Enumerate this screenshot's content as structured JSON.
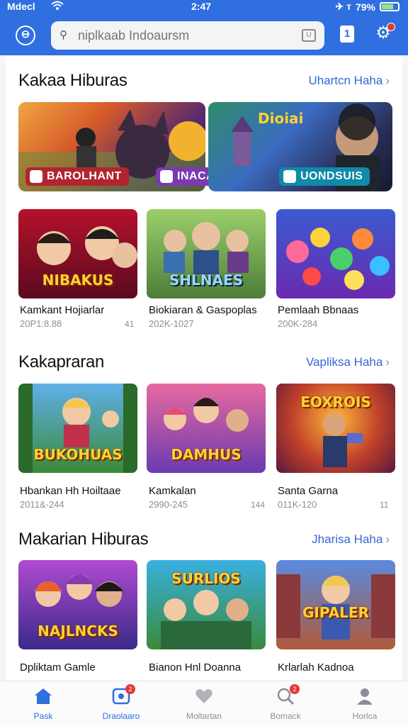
{
  "status": {
    "carrier": "Mdecl",
    "time": "2:47",
    "right_icons": "✈ ᴛ",
    "battery": "79%"
  },
  "search": {
    "placeholder": "niplkaab Indoaursm"
  },
  "sections": [
    {
      "title": "Kakaa Hiburas",
      "see_all": "Uhartcn Haha"
    },
    {
      "title": "Kakapraran",
      "see_all": "Vapliksa Haha"
    },
    {
      "title": "Makarian Hiburas",
      "see_all": "Jharisa Haha"
    }
  ],
  "banners": [
    {
      "label": "BAROLHANT"
    },
    {
      "label": "INACACAS"
    },
    {
      "label": "UONDSUIS"
    }
  ],
  "row1": [
    {
      "wordmark": "NIBAKUS",
      "name": "Kamkant Hojiarlar",
      "meta": "20P1:8.88",
      "rank": "41"
    },
    {
      "wordmark": "SHLNAES",
      "name": "Biokiaran & Gaspoplas",
      "meta": "202K-1027",
      "rank": ""
    },
    {
      "wordmark": "",
      "name": "Pemlaah Bbnaas",
      "meta": "200K-284",
      "rank": ""
    }
  ],
  "row2": [
    {
      "wordmark": "BUKOHUAS",
      "name": "Hbankan Hh Hoiltaae",
      "meta": "2011&-244",
      "rank": ""
    },
    {
      "wordmark": "DAMHUS",
      "name": "Kamkalan",
      "meta": "2990-245",
      "rank": "144"
    },
    {
      "wordmark": "EOXROIS",
      "name": "Santa Garna",
      "meta": "011K-120",
      "rank": "11"
    }
  ],
  "row3": [
    {
      "wordmark": "NAJLNCKS",
      "name": "Dpliktam Gamle",
      "meta": "",
      "rank": ""
    },
    {
      "wordmark": "SURLIOS",
      "name": "Bianon Hnl Doanna",
      "meta": "",
      "rank": ""
    },
    {
      "wordmark": "GIPALER",
      "name": "Krlarlah Kadnoa",
      "meta": "",
      "rank": ""
    }
  ],
  "tabs": [
    {
      "label": "Pask",
      "icon": "home-icon",
      "badge": ""
    },
    {
      "label": "Draolaaro",
      "icon": "games-icon",
      "badge": "2"
    },
    {
      "label": "Moltartan",
      "icon": "heart-icon",
      "badge": ""
    },
    {
      "label": "Bomack",
      "icon": "search-icon",
      "badge": "2"
    },
    {
      "label": "Horlca",
      "icon": "person-icon",
      "badge": ""
    }
  ],
  "colors": {
    "primary": "#2f6fe0",
    "link": "#3167d4",
    "badge": "#e53935"
  }
}
